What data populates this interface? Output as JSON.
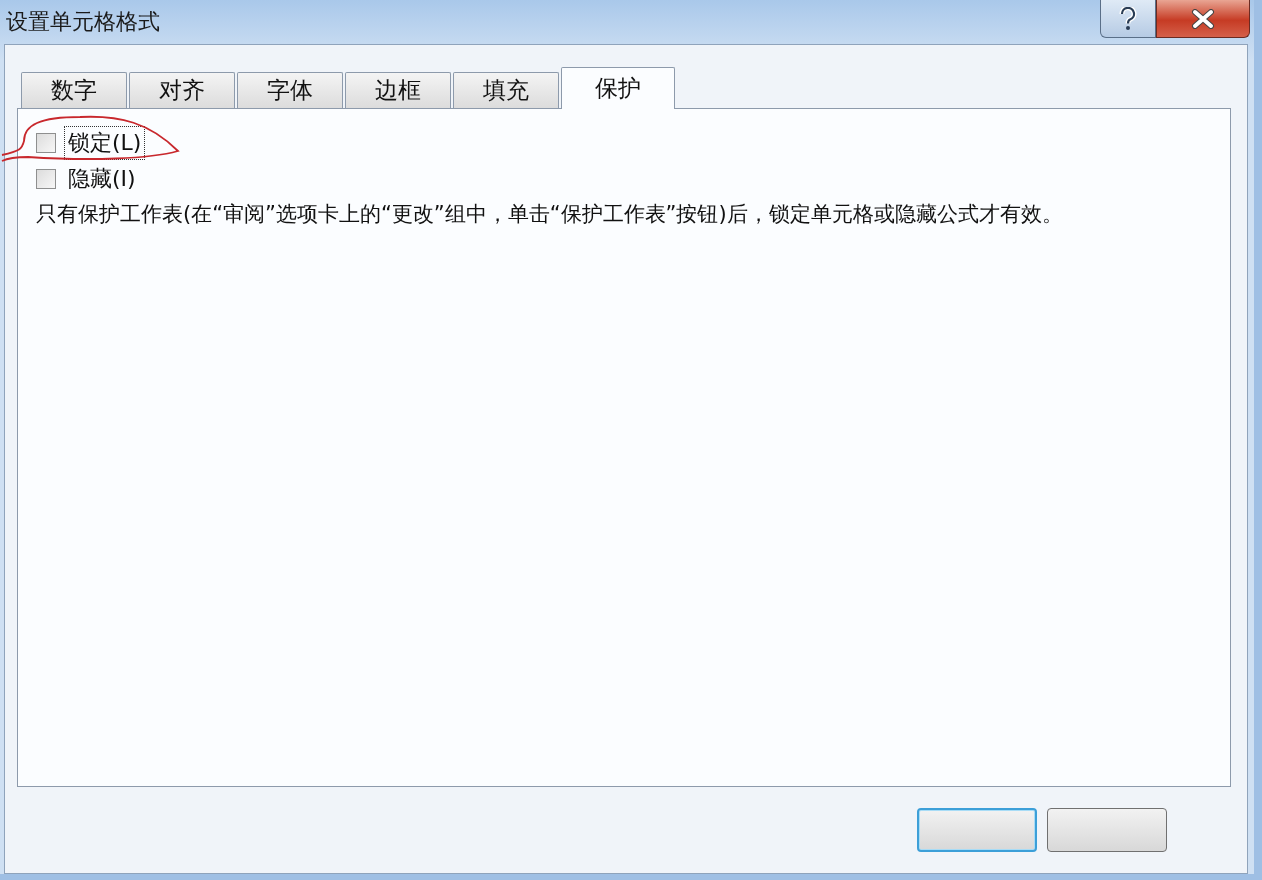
{
  "window": {
    "title": "设置单元格格式"
  },
  "tabs": [
    {
      "label": "数字",
      "selected": false
    },
    {
      "label": "对齐",
      "selected": false
    },
    {
      "label": "字体",
      "selected": false
    },
    {
      "label": "边框",
      "selected": false
    },
    {
      "label": "填充",
      "selected": false
    },
    {
      "label": "保护",
      "selected": true
    }
  ],
  "options": [
    {
      "label": "锁定(L)",
      "checked": false,
      "focused": true
    },
    {
      "label": "隐藏(I)",
      "checked": false,
      "focused": false
    }
  ],
  "note": "只有保护工作表(在“审阅”选项卡上的“更改”组中，单击“保护工作表”按钮)后，锁定单元格或隐藏公式才有效。",
  "buttons": [
    {
      "default": true
    },
    {
      "default": false
    }
  ]
}
